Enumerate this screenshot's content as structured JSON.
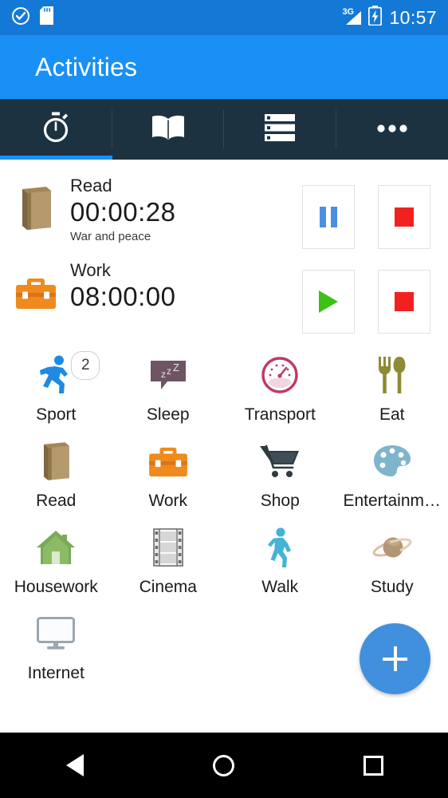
{
  "status_bar": {
    "icons": [
      "clock-check-icon",
      "sd-card-icon"
    ],
    "network": "3G",
    "battery": "battery-charging-icon",
    "time": "10:57",
    "background": "#1479d6"
  },
  "app_bar": {
    "title": "Activities",
    "background": "#1890f5"
  },
  "tabs": {
    "background": "#1d3240",
    "active_color": "#1890f5",
    "items": [
      {
        "name": "timer",
        "icon": "stopwatch-icon",
        "active": true
      },
      {
        "name": "journal",
        "icon": "book-icon",
        "active": false
      },
      {
        "name": "list",
        "icon": "list-icon",
        "active": false
      },
      {
        "name": "more",
        "icon": "overflow-dots-icon",
        "active": false
      }
    ]
  },
  "running": [
    {
      "icon": "book-icon",
      "name": "Read",
      "time": "00:00:28",
      "subtitle": "War and peace",
      "actions": [
        {
          "name": "pause-button",
          "icon": "pause-icon",
          "color": "#4a90e2"
        },
        {
          "name": "stop-button",
          "icon": "stop-icon",
          "color": "#f32020"
        }
      ]
    },
    {
      "icon": "toolbox-icon",
      "name": "Work",
      "time": "08:00:00",
      "subtitle": "",
      "actions": [
        {
          "name": "play-button",
          "icon": "play-icon",
          "color": "#3cc217"
        },
        {
          "name": "stop-button",
          "icon": "stop-icon",
          "color": "#f32020"
        }
      ]
    }
  ],
  "activities": [
    {
      "label": "Sport",
      "icon": "runner-icon",
      "badge": "2"
    },
    {
      "label": "Sleep",
      "icon": "sleep-zzz-icon",
      "badge": ""
    },
    {
      "label": "Transport",
      "icon": "speedometer-icon",
      "badge": ""
    },
    {
      "label": "Eat",
      "icon": "cutlery-icon",
      "badge": ""
    },
    {
      "label": "Read",
      "icon": "book-icon",
      "badge": ""
    },
    {
      "label": "Work",
      "icon": "toolbox-icon",
      "badge": ""
    },
    {
      "label": "Shop",
      "icon": "shopping-cart-icon",
      "badge": ""
    },
    {
      "label": "Entertainm…",
      "icon": "palette-icon",
      "badge": ""
    },
    {
      "label": "Housework",
      "icon": "house-icon",
      "badge": ""
    },
    {
      "label": "Cinema",
      "icon": "film-strip-icon",
      "badge": ""
    },
    {
      "label": "Walk",
      "icon": "walking-icon",
      "badge": ""
    },
    {
      "label": "Study",
      "icon": "planet-icon",
      "badge": ""
    },
    {
      "label": "Internet",
      "icon": "monitor-icon",
      "badge": ""
    }
  ],
  "fab": {
    "icon": "plus-icon",
    "color": "#4190dd"
  },
  "nav_bar": {
    "back": "back-triangle-icon",
    "home": "home-circle-icon",
    "recents": "recents-square-icon"
  }
}
